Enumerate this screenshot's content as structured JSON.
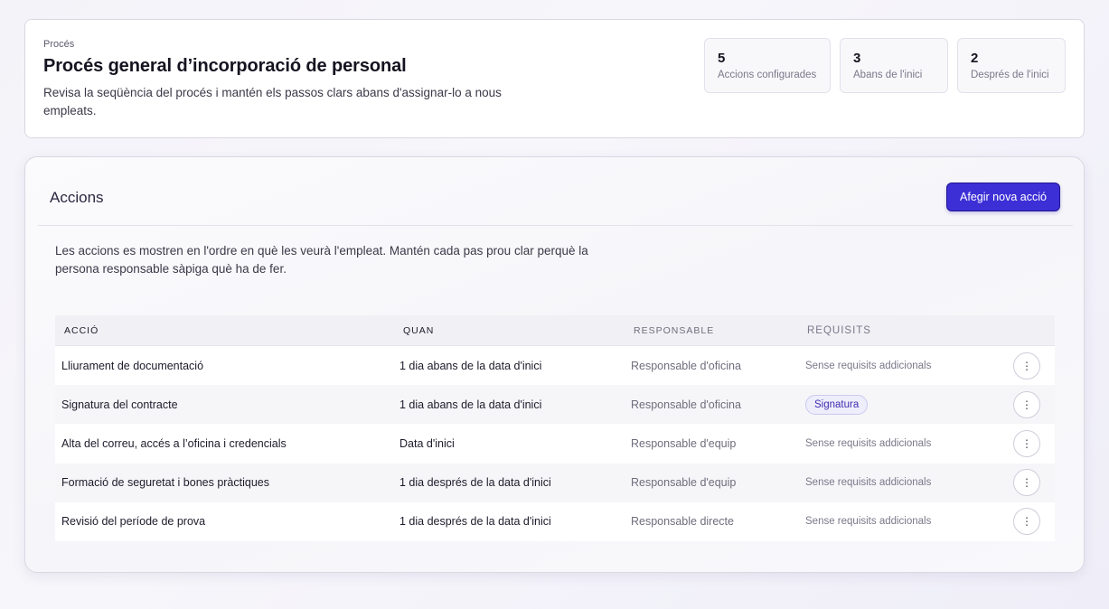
{
  "header": {
    "eyebrow": "Procés",
    "title": "Procés general d’incorporació de personal",
    "description": "Revisa la seqüència del procés i mantén els passos clars abans d'assignar-lo a nous empleats."
  },
  "stats": [
    {
      "value": "5",
      "label": "Accions configurades"
    },
    {
      "value": "3",
      "label": "Abans de l'inici"
    },
    {
      "value": "2",
      "label": "Després de l'inici"
    }
  ],
  "actions_section": {
    "title": "Accions",
    "add_button_label": "Afegir nova acció",
    "intro": "Les accions es mostren en l'ordre en què les veurà l'empleat. Mantén cada pas prou clar perquè la persona responsable sàpiga què ha de fer."
  },
  "table": {
    "headers": {
      "action": "ACCIÓ",
      "when": "QUAN",
      "owner": "RESPONSABLE",
      "requirements": "REQUISITS"
    },
    "rows": [
      {
        "action": "Lliurament de documentació",
        "when": "1 dia abans de la data d'inici",
        "owner": "Responsable d'oficina",
        "requirements": "Sense requisits addicionals",
        "menu_icon": "⋮"
      },
      {
        "action": "Signatura del contracte",
        "when": "1 dia abans de la data d'inici",
        "owner": "Responsable d'oficina",
        "requirements": "Signatura",
        "menu_icon": "⋮"
      },
      {
        "action": "Alta del correu, accés a l’oficina i credencials",
        "when": "Data d'inici",
        "owner": "Responsable d'equip",
        "requirements": "Sense requisits addicionals",
        "menu_icon": "⋮"
      },
      {
        "action": "Formació de seguretat i bones pràctiques",
        "when": "1 dia després de la data d'inici",
        "owner": "Responsable d'equip",
        "requirements": "Sense requisits addicionals",
        "menu_icon": "⋮"
      },
      {
        "action": "Revisió del període de prova",
        "when": "1 dia després de la data d'inici",
        "owner": "Responsable directe",
        "requirements": "Sense requisits addicionals",
        "menu_icon": "⋮"
      }
    ]
  },
  "colors": {
    "accent": "#3d2fd6",
    "badge_text": "#3d2fb0",
    "badge_bg": "#eeedfb"
  }
}
